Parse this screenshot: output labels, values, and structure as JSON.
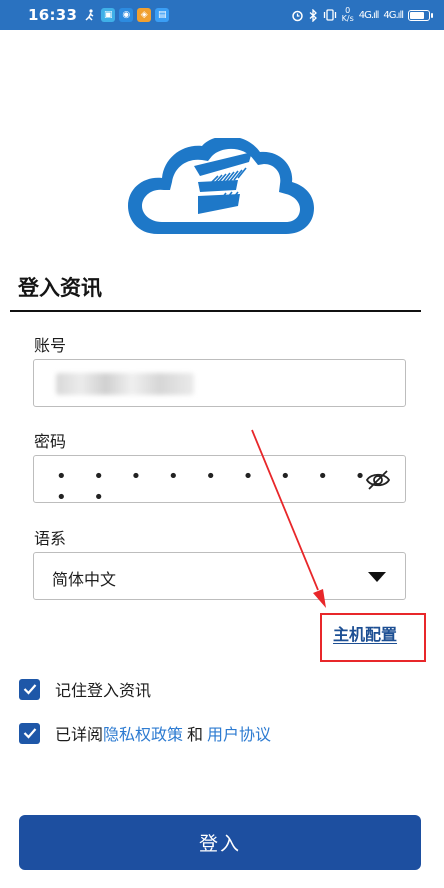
{
  "status_bar": {
    "time": "16:33",
    "net_speed_value": "0",
    "net_speed_unit": "K/s",
    "signal_1": "4G.ıll",
    "signal_2": "4G.ıll"
  },
  "form": {
    "section_title": "登入资讯",
    "account": {
      "label": "账号"
    },
    "password": {
      "label": "密码",
      "masked_value": "• • • • • • • • • • •"
    },
    "language": {
      "label": "语系",
      "selected": "简体中文"
    },
    "host_config_link": "主机配置"
  },
  "options": {
    "remember": {
      "label": "记住登入资讯",
      "checked": true
    },
    "agree": {
      "prefix": "已详阅",
      "privacy_link": "隐私权政策",
      "and": "和",
      "terms_link": "用户协议",
      "checked": true
    }
  },
  "login_button": {
    "label": "登入"
  },
  "colors": {
    "status_bar": "#2a72c0",
    "brand_blue": "#1e78c8",
    "primary_button": "#1d4fa0",
    "checkbox": "#1e57a8",
    "link": "#2d7bd1",
    "annotation_red": "#e8272a"
  },
  "icons": {
    "logo": "cloud-logo",
    "password_toggle": "eye-slash-icon",
    "dropdown": "caret-down-icon",
    "checkbox": "check-icon"
  }
}
